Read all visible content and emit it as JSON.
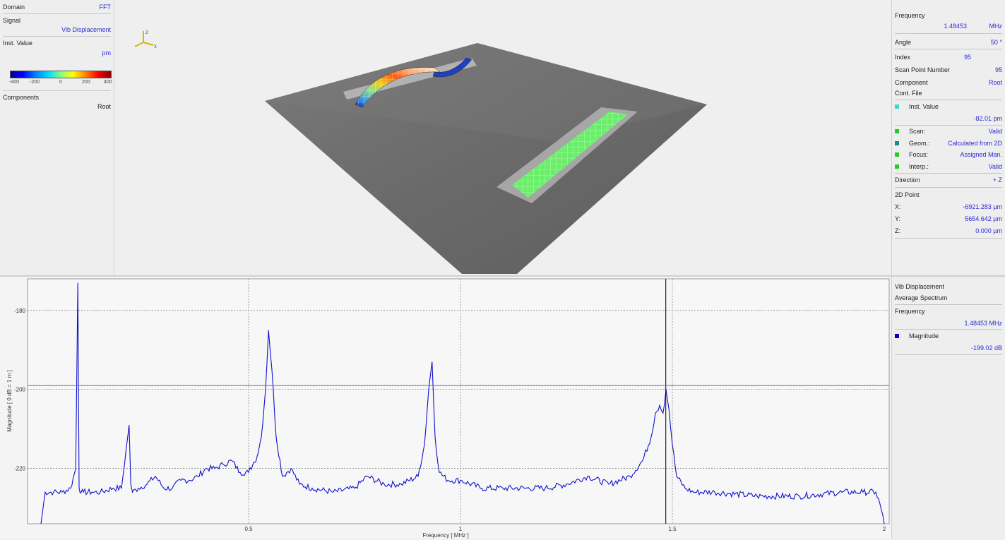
{
  "left_panel": {
    "domain_label": "Domain",
    "domain_value": "FFT",
    "signal_label": "Signal",
    "signal_value": "Vib Displacement",
    "inst_label": "Inst. Value",
    "inst_unit": "pm",
    "colorbar_ticks": [
      "-400",
      "-200",
      "0",
      "200",
      "400"
    ],
    "components_label": "Components",
    "components_value": "Root"
  },
  "right_top": {
    "frequency_label": "Frequency",
    "frequency_value": "1.48453",
    "frequency_unit": "MHz",
    "angle_label": "Angle",
    "angle_value": "50 °",
    "index_label": "Index",
    "index_value": "95",
    "scan_point_label": "Scan Point Number",
    "scan_point_value": "95",
    "component_label": "Component",
    "component_value": "Root",
    "cont_file_label": "Cont. File",
    "inst_value_label": "Inst. Value",
    "inst_value_value": "-82.01 pm",
    "scan_label": "Scan:",
    "scan_value": "Valid",
    "geom_label": "Geom.:",
    "geom_value": "Calculated from 2D",
    "focus_label": "Focus:",
    "focus_value": "Assigned Man.",
    "interp_label": "Interp.:",
    "interp_value": "Valid",
    "direction_label": "Direction",
    "direction_value": "+ Z",
    "point2d_label": "2D Point",
    "x_label": "X:",
    "x_value": "-6921.283 µm",
    "y_label": "Y:",
    "y_value": "5654.642 µm",
    "z_label": "Z:",
    "z_value": "0.000 µm",
    "colors": {
      "inst": "#35d6d6",
      "scan": "#22cc22",
      "geom": "#1a8a8a",
      "focus": "#22cc22",
      "interp": "#22cc22"
    }
  },
  "right_bottom": {
    "signal": "Vib Displacement",
    "spectrum": "Average Spectrum",
    "frequency_label": "Frequency",
    "frequency_value": "1.48453 MHz",
    "magnitude_label": "Magnitude",
    "magnitude_value": "-199.02 dB",
    "magnitude_color": "#0000cc"
  },
  "viewport": {
    "axis_label_x": "x",
    "axis_label_z": "z"
  },
  "chart_data": {
    "type": "line",
    "xlabel": "Frequency [ MHz ]",
    "ylabel": "Magnitude [ 0 dB = 1 m ]",
    "xlim": [
      0.0,
      2.0
    ],
    "ylim": [
      -234,
      -172
    ],
    "x_ticks": [
      {
        "value": 0.5,
        "label": "0.5"
      },
      {
        "value": 1.0,
        "label": "1"
      },
      {
        "value": 1.5,
        "label": "1.5"
      },
      {
        "value": 2.0,
        "label": "2"
      }
    ],
    "y_ticks": [
      {
        "value": -180,
        "label": "-180"
      },
      {
        "value": -200,
        "label": "-200"
      },
      {
        "value": -220,
        "label": "-220"
      }
    ],
    "grid": true,
    "cursor_x": 1.48453,
    "cursor_y": -199.02,
    "series": [
      {
        "color": "#1010cc",
        "x": [
          0.01,
          0.02,
          0.04,
          0.06,
          0.08,
          0.092,
          0.097,
          0.1,
          0.105,
          0.11,
          0.13,
          0.15,
          0.18,
          0.2,
          0.218,
          0.222,
          0.226,
          0.24,
          0.26,
          0.28,
          0.3,
          0.32,
          0.34,
          0.36,
          0.38,
          0.4,
          0.42,
          0.44,
          0.46,
          0.48,
          0.5,
          0.51,
          0.52,
          0.53,
          0.54,
          0.547,
          0.555,
          0.565,
          0.58,
          0.6,
          0.62,
          0.65,
          0.7,
          0.75,
          0.78,
          0.82,
          0.86,
          0.9,
          0.915,
          0.925,
          0.933,
          0.94,
          0.95,
          0.97,
          1.0,
          1.05,
          1.1,
          1.15,
          1.2,
          1.25,
          1.3,
          1.35,
          1.4,
          1.43,
          1.45,
          1.46,
          1.47,
          1.478,
          1.485,
          1.492,
          1.5,
          1.51,
          1.53,
          1.55,
          1.6,
          1.7,
          1.8,
          1.9,
          1.95,
          1.98,
          1.99,
          2.0
        ],
        "y": [
          -234,
          -226,
          -226,
          -226,
          -225,
          -220,
          -173,
          -225,
          -226,
          -226,
          -226,
          -226,
          -225,
          -225,
          -209,
          -224,
          -226,
          -225,
          -224,
          -222,
          -225,
          -225,
          -223,
          -223,
          -222,
          -220,
          -220,
          -219,
          -218,
          -221,
          -221,
          -219,
          -217,
          -212,
          -200,
          -185,
          -195,
          -212,
          -222,
          -220,
          -224,
          -225,
          -226,
          -225,
          -222,
          -224,
          -224,
          -222,
          -214,
          -200,
          -193,
          -212,
          -221,
          -223,
          -223,
          -225,
          -225,
          -225,
          -225,
          -224,
          -222,
          -224,
          -222,
          -218,
          -212,
          -206,
          -204,
          -206,
          -200,
          -205,
          -214,
          -222,
          -225,
          -226,
          -226,
          -227,
          -227,
          -226,
          -226,
          -226,
          -229,
          -234
        ]
      }
    ]
  }
}
